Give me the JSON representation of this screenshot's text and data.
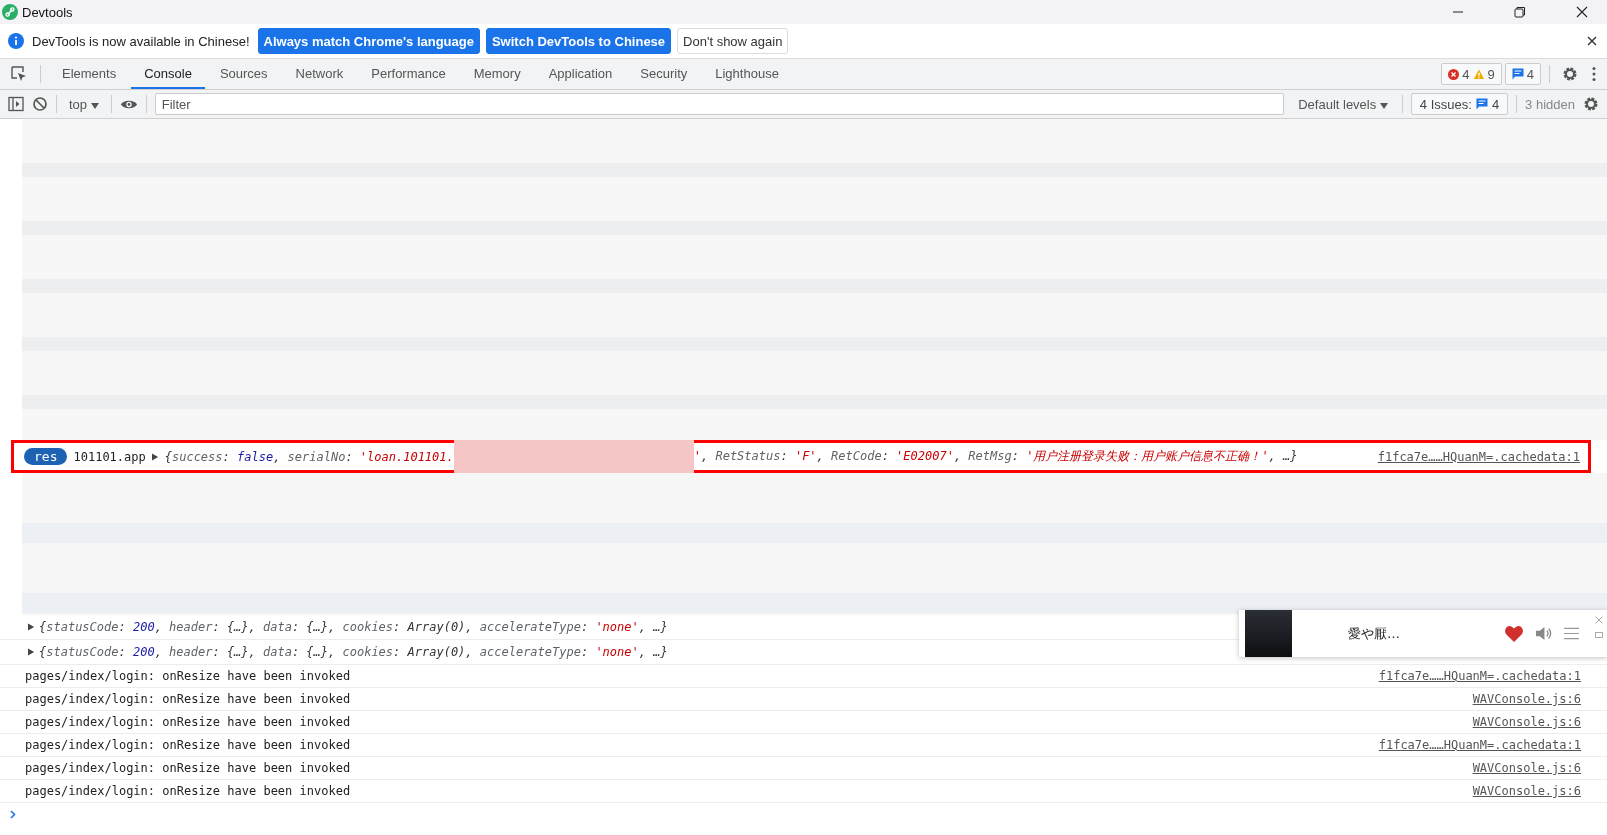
{
  "window": {
    "title": "Devtools"
  },
  "infobar": {
    "message": "DevTools is now available in Chinese!",
    "buttons": [
      {
        "label": "Always match Chrome's language",
        "kind": "primary"
      },
      {
        "label": "Switch DevTools to Chinese",
        "kind": "primary"
      },
      {
        "label": "Don't show again",
        "kind": "plain"
      }
    ]
  },
  "tabs": [
    {
      "label": "Elements",
      "selected": false
    },
    {
      "label": "Console",
      "selected": true
    },
    {
      "label": "Sources",
      "selected": false
    },
    {
      "label": "Network",
      "selected": false
    },
    {
      "label": "Performance",
      "selected": false
    },
    {
      "label": "Memory",
      "selected": false
    },
    {
      "label": "Application",
      "selected": false
    },
    {
      "label": "Security",
      "selected": false
    },
    {
      "label": "Lighthouse",
      "selected": false
    }
  ],
  "counters": {
    "errors": "4",
    "warnings": "9",
    "messages": "4"
  },
  "console_toolbar": {
    "context": "top",
    "filter_placeholder": "Filter",
    "levels": "Default levels",
    "issues_label": "4 Issues:",
    "issues_count": "4",
    "hidden": "3 hidden"
  },
  "highlighted_entry": {
    "badge": "res",
    "prefix": "101101.app",
    "tokens_before": [
      {
        "kind": "p",
        "text": "{"
      },
      {
        "kind": "k",
        "text": "success"
      },
      {
        "kind": "p",
        "text": ": "
      },
      {
        "kind": "b",
        "text": "false"
      },
      {
        "kind": "p",
        "text": ", "
      },
      {
        "kind": "k",
        "text": "serialNo"
      },
      {
        "kind": "p",
        "text": ": "
      },
      {
        "kind": "s",
        "text": "'loan.101101."
      }
    ],
    "tokens_after": [
      {
        "kind": "s",
        "text": "'"
      },
      {
        "kind": "p",
        "text": ", "
      },
      {
        "kind": "k",
        "text": "RetStatus"
      },
      {
        "kind": "p",
        "text": ": "
      },
      {
        "kind": "s",
        "text": "'F'"
      },
      {
        "kind": "p",
        "text": ", "
      },
      {
        "kind": "k",
        "text": "RetCode"
      },
      {
        "kind": "p",
        "text": ": "
      },
      {
        "kind": "s",
        "text": "'E02007'"
      },
      {
        "kind": "p",
        "text": ", "
      },
      {
        "kind": "k",
        "text": "RetMsg"
      },
      {
        "kind": "p",
        "text": ": "
      },
      {
        "kind": "s",
        "text": "'用户注册登录失败：用户账户信息不正确！'"
      },
      {
        "kind": "p",
        "text": ", …}"
      }
    ],
    "source": "f1fca7e……HQuanM=.cachedata:1"
  },
  "entries": [
    {
      "kind": "object",
      "tokens": [
        {
          "kind": "p",
          "text": "{"
        },
        {
          "kind": "k",
          "text": "statusCode"
        },
        {
          "kind": "p",
          "text": ": "
        },
        {
          "kind": "b",
          "text": "200"
        },
        {
          "kind": "p",
          "text": ", "
        },
        {
          "kind": "k",
          "text": "header"
        },
        {
          "kind": "p",
          "text": ": {…}, "
        },
        {
          "kind": "k",
          "text": "data"
        },
        {
          "kind": "p",
          "text": ": {…}, "
        },
        {
          "kind": "k",
          "text": "cookies"
        },
        {
          "kind": "p",
          "text": ": Array(0), "
        },
        {
          "kind": "k",
          "text": "accelerateType"
        },
        {
          "kind": "p",
          "text": ": "
        },
        {
          "kind": "s",
          "text": "'none'"
        },
        {
          "kind": "p",
          "text": ", …}"
        }
      ]
    },
    {
      "kind": "object",
      "tokens": [
        {
          "kind": "p",
          "text": "{"
        },
        {
          "kind": "k",
          "text": "statusCode"
        },
        {
          "kind": "p",
          "text": ": "
        },
        {
          "kind": "b",
          "text": "200"
        },
        {
          "kind": "p",
          "text": ", "
        },
        {
          "kind": "k",
          "text": "header"
        },
        {
          "kind": "p",
          "text": ": {…}, "
        },
        {
          "kind": "k",
          "text": "data"
        },
        {
          "kind": "p",
          "text": ": {…}, "
        },
        {
          "kind": "k",
          "text": "cookies"
        },
        {
          "kind": "p",
          "text": ": Array(0), "
        },
        {
          "kind": "k",
          "text": "accelerateType"
        },
        {
          "kind": "p",
          "text": ": "
        },
        {
          "kind": "s",
          "text": "'none'"
        },
        {
          "kind": "p",
          "text": ", …}"
        }
      ]
    },
    {
      "kind": "log",
      "text": "pages/index/login: onResize have been invoked",
      "source": "f1fca7e……HQuanM=.cachedata:1"
    },
    {
      "kind": "log",
      "text": "pages/index/login: onResize have been invoked",
      "source": "WAVConsole.js:6"
    },
    {
      "kind": "log",
      "text": "pages/index/login: onResize have been invoked",
      "source": "WAVConsole.js:6"
    },
    {
      "kind": "log",
      "text": "pages/index/login: onResize have been invoked",
      "source": "f1fca7e……HQuanM=.cachedata:1"
    },
    {
      "kind": "log",
      "text": "pages/index/login: onResize have been invoked",
      "source": "WAVConsole.js:6"
    },
    {
      "kind": "log",
      "text": "pages/index/login: onResize have been invoked",
      "source": "WAVConsole.js:6"
    }
  ],
  "music_player": {
    "title": "愛や厭…",
    "liked": true
  }
}
